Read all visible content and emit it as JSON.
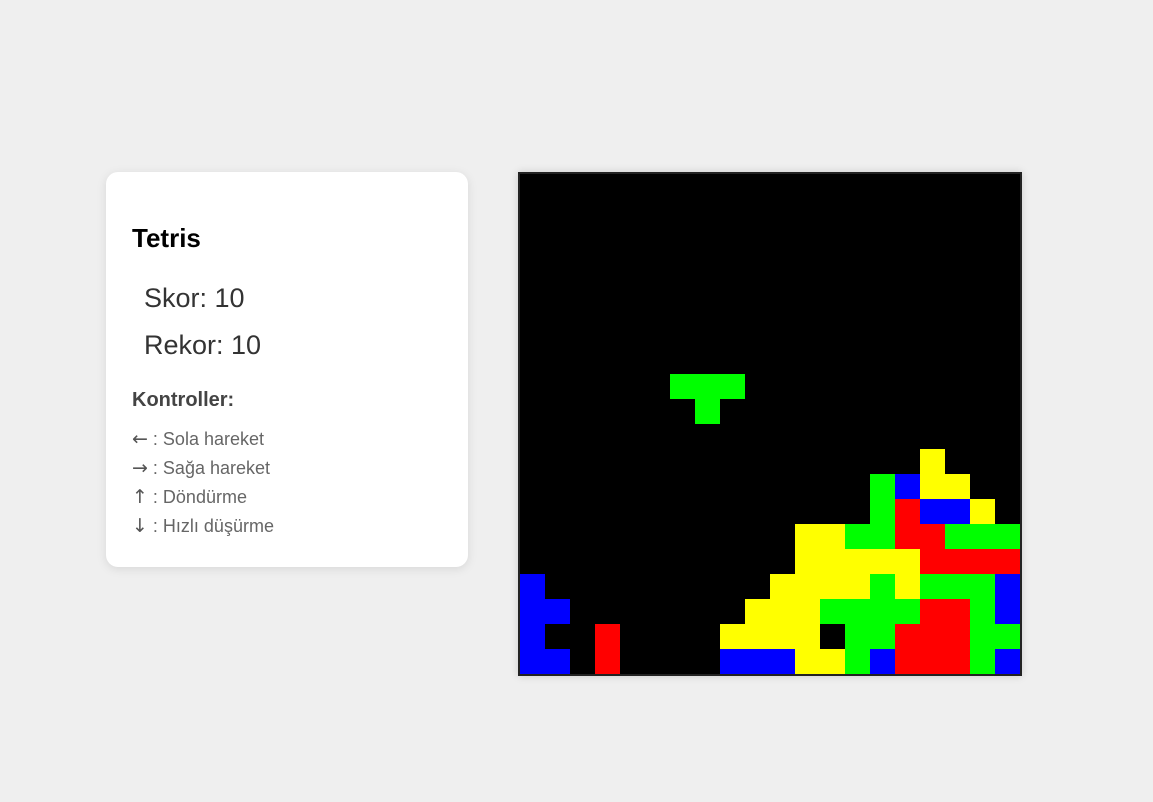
{
  "panel": {
    "title": "Tetris",
    "score": "Skor: 10",
    "record": "Rekor: 10",
    "controls_heading": "Kontroller:",
    "controls": [
      {
        "arrow": "←",
        "label": " : Sola hareket"
      },
      {
        "arrow": "→",
        "label": " : Sağa hareket"
      },
      {
        "arrow": "↑",
        "label": " : Döndürme"
      },
      {
        "arrow": "↓",
        "label": " : Hızlı düşürme"
      }
    ]
  },
  "colors": {
    "Y": "#ffff00",
    "G": "#00ff00",
    "R": "#ff0000",
    "B": "#0000ff",
    "empty": "#000000"
  },
  "board": {
    "cols": 20,
    "rows": 20,
    "grid": [
      "....................",
      "....................",
      "....................",
      "....................",
      "....................",
      "....................",
      "....................",
      "....................",
      "....................",
      "....................",
      "....................",
      "................Y...",
      "..............GBYY..",
      "..............GRBBY.",
      "...........YYGGRRGGG",
      "...........YYYYYRRRR",
      "B.........YYYYGYGGGB",
      "BB.......YYYGGGGRRGB",
      "B..R....YYYY.GGRRRGG",
      "BB.R....BBBYYGBRRRGB"
    ]
  },
  "falling_piece": {
    "type": "T",
    "color_key": "G",
    "cells": [
      [
        6,
        8
      ],
      [
        7,
        8
      ],
      [
        8,
        8
      ],
      [
        7,
        9
      ]
    ]
  }
}
